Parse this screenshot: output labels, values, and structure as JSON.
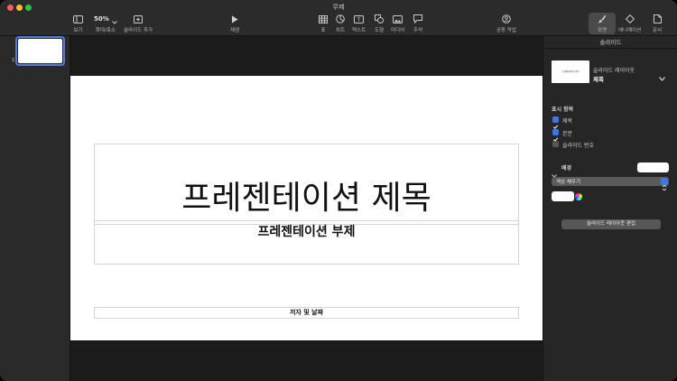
{
  "window": {
    "title": "무제"
  },
  "toolbar": {
    "view_label": "보기",
    "zoom_value": "50%",
    "zoom_label": "확대/축소",
    "add_slide_label": "슬라이드 추가",
    "play_label": "재생",
    "table_label": "표",
    "chart_label": "차트",
    "text_label": "텍스트",
    "shape_label": "도형",
    "media_label": "미디어",
    "comment_label": "주석",
    "collaborate_label": "공동 작업",
    "format_label": "포맷",
    "animate_label": "애니메이션",
    "document_label": "문서"
  },
  "navigator": {
    "slides": [
      {
        "number": "1"
      }
    ]
  },
  "slide": {
    "title": "프레젠테이션 제목",
    "subtitle": "프레젠테이션 부제",
    "author_date": "저자 및 날짜"
  },
  "inspector": {
    "header": "슬라이드",
    "layout_thumb_text": "프레젠테이션 제목",
    "layout_label": "슬라이드 레이아웃",
    "layout_value": "제목",
    "display_section": "표시 항목",
    "options": [
      {
        "label": "제목",
        "checked": true
      },
      {
        "label": "본문",
        "checked": true
      },
      {
        "label": "슬라이드 번호",
        "checked": false
      }
    ],
    "background_label": "배경",
    "fill_type": "색상 채우기",
    "edit_layout_button": "슬라이드 레이아웃 편집"
  },
  "colors": {
    "accent": "#3b78e0",
    "toolbar_bg": "#2b2b2b",
    "canvas_bg": "#1b1b1b",
    "slide_bg": "#ffffff"
  }
}
